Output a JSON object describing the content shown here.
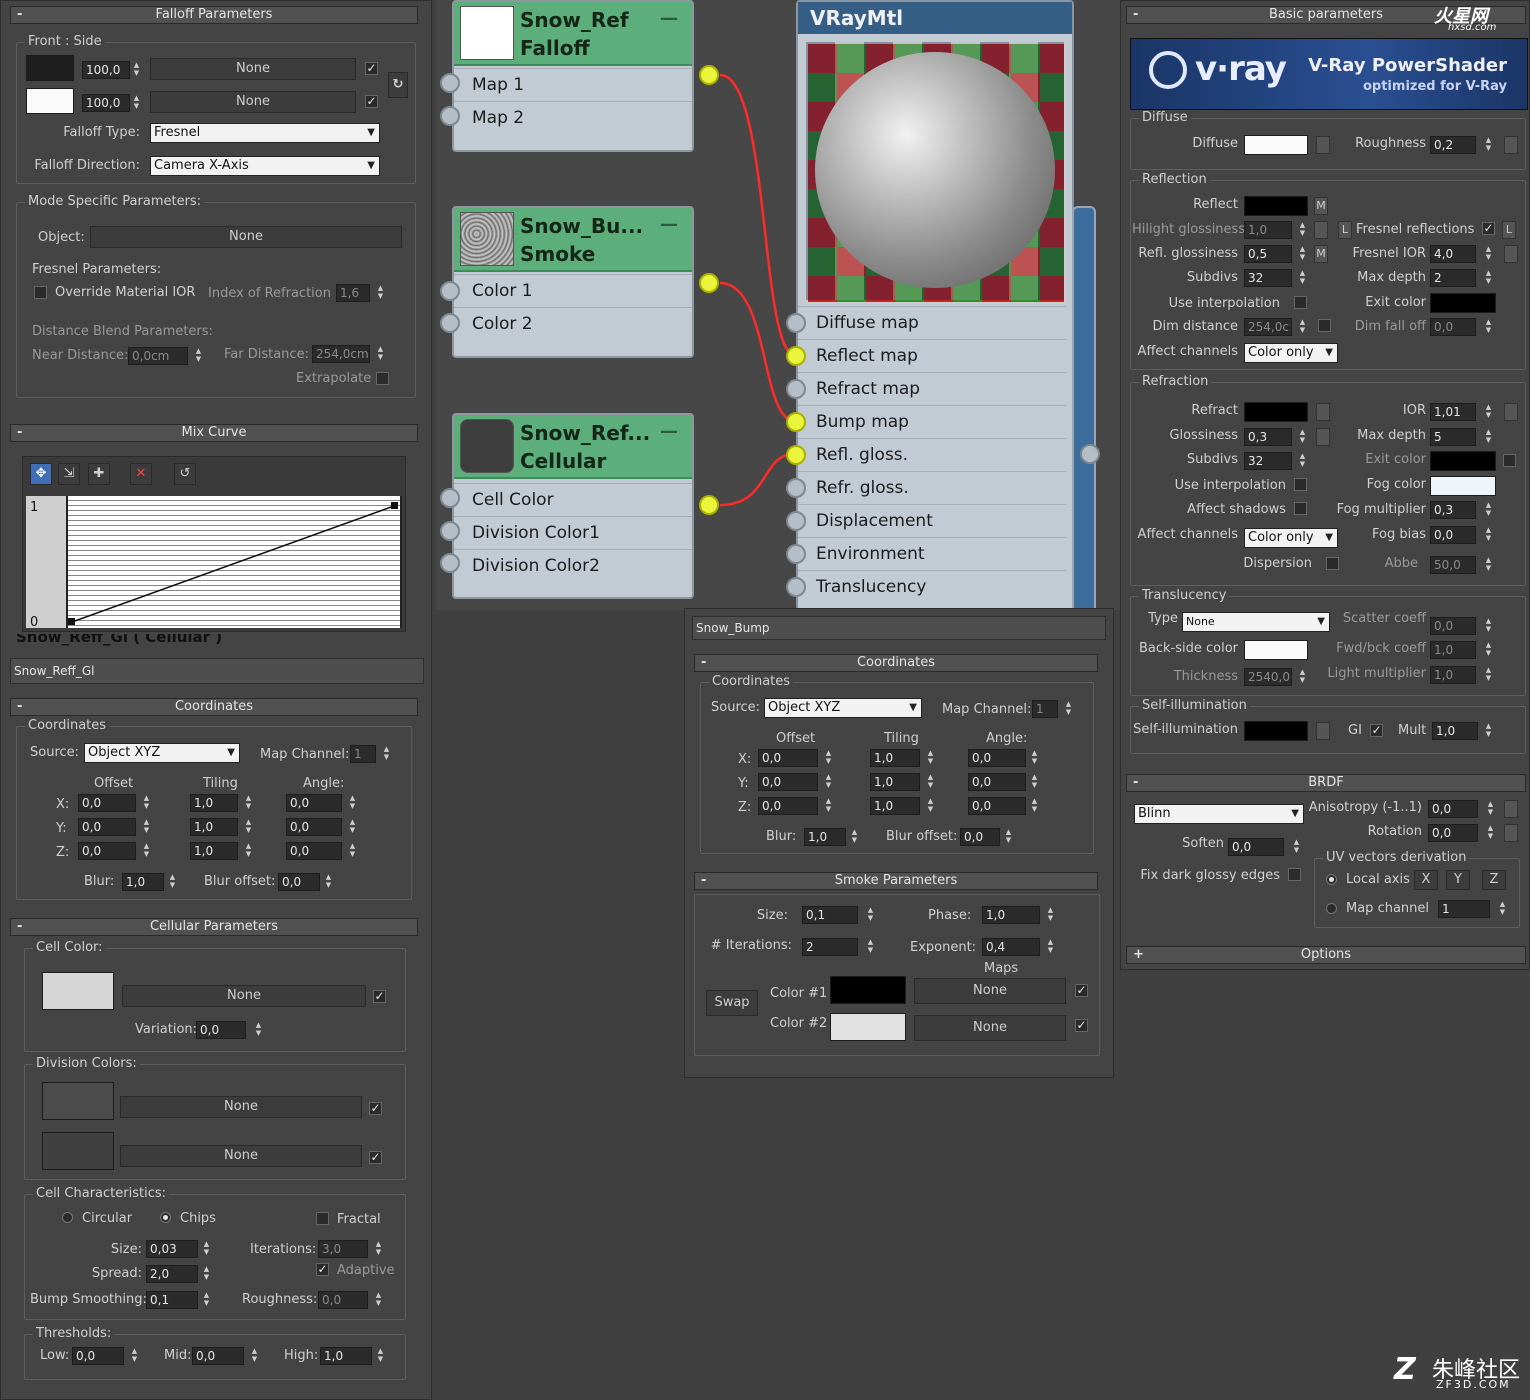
{
  "falloff": {
    "bar": "Falloff Parameters",
    "group": "Front : Side",
    "v1": "100,0",
    "v2": "100,0",
    "none": "None",
    "type_label": "Falloff Type:",
    "type_value": "Fresnel",
    "dir_label": "Falloff Direction:",
    "dir_value": "Camera X-Axis",
    "mode": "Mode Specific Parameters:",
    "object_label": "Object:",
    "object_value": "None",
    "fresnel": "Fresnel Parameters:",
    "override": "Override Material IOR",
    "ior_label": "Index of Refraction",
    "ior_value": "1,6",
    "distance": "Distance Blend Parameters:",
    "near_label": "Near Distance:",
    "near_value": "0,0cm",
    "far_label": "Far Distance:",
    "far_value": "254,0cm",
    "extrapolate": "Extrapolate"
  },
  "mixcurve": {
    "bar": "Mix Curve",
    "y1": "1",
    "y0": "0"
  },
  "left_map": {
    "title": "Snow_Reff_Gl ( Cellular )",
    "name": "Snow_Reff_Gl"
  },
  "coords_left": {
    "bar": "Coordinates",
    "group": "Coordinates",
    "source_label": "Source:",
    "source": "Object XYZ",
    "mapch_label": "Map Channel:",
    "mapch": "1",
    "offset": "Offset",
    "tiling": "Tiling",
    "angle": "Angle:",
    "x": "X:",
    "y": "Y:",
    "z": "Z:",
    "off_x": "0,0",
    "off_y": "0,0",
    "off_z": "0,0",
    "til_x": "1,0",
    "til_y": "1,0",
    "til_z": "1,0",
    "ang_x": "0,0",
    "ang_y": "0,0",
    "ang_z": "0,0",
    "blur_label": "Blur:",
    "blur": "1,0",
    "bluroff_label": "Blur offset:",
    "bluroff": "0,0"
  },
  "cellular": {
    "bar": "Cellular Parameters",
    "cell_color": "Cell Color:",
    "none": "None",
    "variation_label": "Variation:",
    "variation": "0,0",
    "division": "Division Colors:",
    "chars": "Cell Characteristics:",
    "circular": "Circular",
    "chips": "Chips",
    "fractal": "Fractal",
    "size_label": "Size:",
    "size": "0,03",
    "iter_label": "Iterations:",
    "iter": "3,0",
    "spread_label": "Spread:",
    "spread": "2,0",
    "adaptive": "Adaptive",
    "bump_label": "Bump Smoothing:",
    "bump": "0,1",
    "rough_label": "Roughness:",
    "rough": "0,0",
    "thresholds": "Thresholds:",
    "low_label": "Low:",
    "low": "0,0",
    "mid_label": "Mid:",
    "mid": "0,0",
    "high_label": "High:",
    "high": "1,0"
  },
  "nodes": {
    "falloff": {
      "t1": "Snow_Ref",
      "t2": "Falloff",
      "s1": "Map 1",
      "s2": "Map 2"
    },
    "smoke": {
      "t1": "Snow_Bu...",
      "t2": "Smoke",
      "s1": "Color 1",
      "s2": "Color 2"
    },
    "cellular": {
      "t1": "Snow_Ref...",
      "t2": "Cellular",
      "s1": "Cell Color",
      "s2": "Division Color1",
      "s3": "Division Color2"
    },
    "vray": {
      "title": "VRayMtl",
      "slots": [
        "Diffuse map",
        "Reflect map",
        "Refract map",
        "Bump map",
        "Refl. gloss.",
        "Refr. gloss.",
        "Displacement",
        "Environment",
        "Translucency"
      ]
    }
  },
  "bump_panel": {
    "name": "Snow_Bump",
    "coords_bar": "Coordinates",
    "group": "Coordinates",
    "source_label": "Source:",
    "source": "Object XYZ",
    "mapch_label": "Map Channel:",
    "mapch": "1",
    "offset": "Offset",
    "tiling": "Tiling",
    "angle": "Angle:",
    "x": "X:",
    "y": "Y:",
    "z": "Z:",
    "off_x": "0,0",
    "off_y": "0,0",
    "off_z": "0,0",
    "til_x": "1,0",
    "til_y": "1,0",
    "til_z": "1,0",
    "ang_x": "0,0",
    "ang_y": "0,0",
    "ang_z": "0,0",
    "blur_label": "Blur:",
    "blur": "1,0",
    "bluroff_label": "Blur offset:",
    "bluroff": "0,0",
    "smoke_bar": "Smoke Parameters",
    "size_label": "Size:",
    "size": "0,1",
    "phase_label": "Phase:",
    "phase": "1,0",
    "iter_label": "# Iterations:",
    "iter": "2",
    "exp_label": "Exponent:",
    "exp": "0,4",
    "maps": "Maps",
    "swap": "Swap",
    "c1": "Color #1",
    "c2": "Color #2",
    "none": "None"
  },
  "vray": {
    "bar": "Basic parameters",
    "logo": "v·ray",
    "brand1": "V-Ray PowerShader",
    "brand2": "optimized for V-Ray",
    "watermark": "火星网",
    "watermark_url": "hxsd.com",
    "diffuse_group": "Diffuse",
    "diffuse": "Diffuse",
    "roughness": "Roughness",
    "roughness_v": "0,2",
    "refl_group": "Reflection",
    "reflect": "Reflect",
    "hilight": "Hilight glossiness",
    "hilight_v": "1,0",
    "fresnel_refl": "Fresnel reflections",
    "refl_gloss": "Refl. glossiness",
    "refl_gloss_v": "0,5",
    "fresnel_ior": "Fresnel IOR",
    "fresnel_ior_v": "4,0",
    "subdivs": "Subdivs",
    "subdivs_v": "32",
    "maxdepth": "Max depth",
    "maxdepth_v": "2",
    "use_interp": "Use interpolation",
    "exit_color": "Exit color",
    "dim_dist": "Dim distance",
    "dim_dist_v": "254,0c",
    "dim_falloff": "Dim fall off",
    "dim_falloff_v": "0,0",
    "affect_ch": "Affect channels",
    "affect_ch_v": "Color only",
    "refr_group": "Refraction",
    "refract": "Refract",
    "ior": "IOR",
    "ior_v": "1,01",
    "glossiness": "Glossiness",
    "glossiness_v": "0,3",
    "maxdepth_r_v": "5",
    "subdivs_r_v": "32",
    "fog_color": "Fog color",
    "affect_sh": "Affect shadows",
    "fog_mult": "Fog multiplier",
    "fog_mult_v": "0,3",
    "fog_bias": "Fog bias",
    "fog_bias_v": "0,0",
    "dispersion": "Dispersion",
    "abbe": "Abbe",
    "abbe_v": "50,0",
    "trans_group": "Translucency",
    "type": "Type",
    "type_v": "None",
    "scatter": "Scatter coeff",
    "scatter_v": "0,0",
    "backside": "Back-side color",
    "fwdbck": "Fwd/bck coeff",
    "fwdbck_v": "1,0",
    "thickness": "Thickness",
    "thickness_v": "2540,0",
    "lightmult": "Light multiplier",
    "lightmult_v": "1,0",
    "self_group": "Self-illumination",
    "self": "Self-illumination",
    "gi": "GI",
    "mult": "Mult",
    "mult_v": "1,0",
    "brdf_bar": "BRDF",
    "brdf_v": "Blinn",
    "aniso": "Anisotropy (-1..1)",
    "aniso_v": "0,0",
    "rotation": "Rotation",
    "rotation_v": "0,0",
    "soften": "Soften",
    "soften_v": "0,0",
    "uv_group": "UV vectors derivation",
    "fix_dark": "Fix dark glossy edges",
    "local_axis": "Local axis",
    "ax_x": "X",
    "ax_y": "Y",
    "ax_z": "Z",
    "map_channel": "Map channel",
    "map_channel_v": "1",
    "options_bar": "Options"
  },
  "brand_footer": {
    "cn": "朱峰社区",
    "url": "ZF3D.COM"
  },
  "colors": {
    "node_header": "#5cae7a",
    "node_body": "#c2cad3",
    "socket_active": "#e9f43a",
    "wire": "#ff2a2a",
    "panel": "#444444",
    "vray_blue": "#1f3f78"
  }
}
